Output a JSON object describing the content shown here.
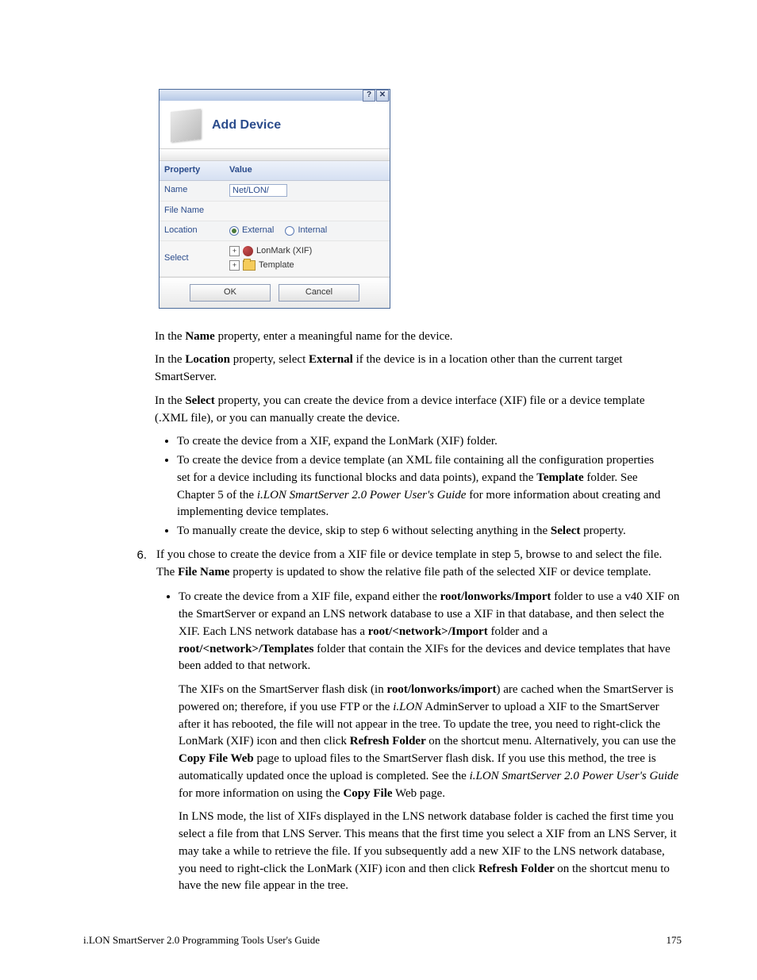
{
  "dialog": {
    "title": "Add Device",
    "headers": {
      "property": "Property",
      "value": "Value"
    },
    "rows": {
      "name_label": "Name",
      "name_value": "Net/LON/",
      "filename_label": "File Name",
      "filename_value": "",
      "location_label": "Location",
      "location_ext": "External",
      "location_int": "Internal",
      "select_label": "Select",
      "tree_lonmark": "LonMark (XIF)",
      "tree_template": "Template"
    },
    "buttons": {
      "ok": "OK",
      "cancel": "Cancel"
    }
  },
  "text": {
    "p1a": "In the ",
    "p1b": "Name",
    "p1c": " property, enter a meaningful name for the device.",
    "p2a": "In the ",
    "p2b": "Location",
    "p2c": " property, select ",
    "p2d": "External",
    "p2e": " if the device is in a location other than the current target SmartServer.",
    "p3a": "In the ",
    "p3b": "Select",
    "p3c": " property, you can create the device from a device interface (XIF) file or a device template (.XML file), or you can manually create the device.",
    "b1": "To create the device from a XIF, expand the LonMark (XIF) folder.",
    "b2a": "To create the device from a device template (an XML file containing all the configuration properties set for a device including its functional blocks and data points), expand the ",
    "b2b": "Template",
    "b2c": " folder. See Chapter 5 of the ",
    "b2d": "i.LON SmartServer 2.0 Power User's Guide",
    "b2e": " for more information about creating and implementing device templates.",
    "b3a": "To manually create the device, skip to step 6 without selecting anything in the ",
    "b3b": "Select",
    "b3c": " property.",
    "step6_num": "6.",
    "s6a": "If you chose to create the device from a XIF file or device template in step 5, browse to and select the file. The ",
    "s6b": "File Name",
    "s6c": " property is updated to show the relative file path of the selected XIF or device template.",
    "s6_sbA": "To create the device from a XIF file, expand either the ",
    "s6_sbB": "root/lonworks/Import",
    "s6_sbC": " folder to use a v40 XIF on the SmartServer or expand an LNS network database to use a XIF in that database, and then select the XIF. Each LNS network database has a ",
    "s6_sbD": "root/<network>/Import",
    "s6_sbE": " folder and a ",
    "s6_sbF": "root/<network>/Templates",
    "s6_sbG": " folder that contain the XIFs for the devices and device templates that have been added to that network.",
    "step6_sub1a": "The XIFs on the SmartServer flash disk (in ",
    "step6_sub1b": "root/lonworks/import",
    "step6_sub1c": ") are cached when the SmartServer is powered on; therefore, if you use FTP or the ",
    "step6_sub1d": "i.LON",
    "step6_sub1e": " AdminServer to upload a XIF to the SmartServer after it has rebooted, the file will not appear in the tree. To update the tree, you need to right-click the LonMark (XIF) icon and then click ",
    "step6_sub1f": "Refresh Folder ",
    "step6_sub1g": "on the shortcut menu. Alternatively, you can use the ",
    "step6_sub1h": "Copy File Web",
    "step6_sub1i": " page to upload files to the SmartServer flash disk. If you use this method, the tree is automatically updated once the upload is completed. See the ",
    "step6_sub1j": "i.",
    "step6_sub1k": "LON SmartServer 2.0 Power User's Guide ",
    "step6_sub1l": "for more information on using the ",
    "step6_sub1m": "Copy File",
    "step6_sub1n": " Web page.",
    "step6_sub2a": "In LNS mode, the list of XIFs displayed in the LNS network database folder is cached the first time you select a file from that LNS Server. This means that the first time you select a XIF from an LNS Server, it may take a while to retrieve the file. If you subsequently add a new XIF to the LNS network database, you need to right-click the LonMark (XIF) icon and then click ",
    "step6_sub2b": "Refresh Folder ",
    "step6_sub2c": "on the shortcut menu to have the new file appear in the tree."
  },
  "footer": {
    "left": "i.LON SmartServer 2.0 Programming Tools User's Guide",
    "right": "175"
  }
}
